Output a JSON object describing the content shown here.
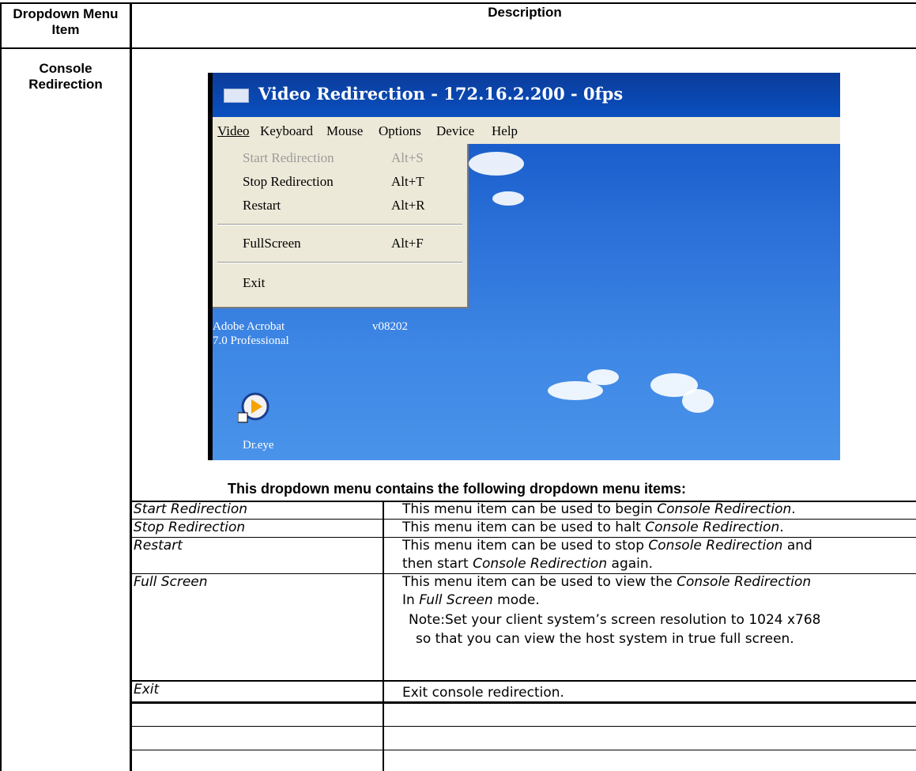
{
  "table": {
    "header_col1": "Dropdown Menu Item",
    "header_col2": "Description",
    "row_label": "Console Redirection"
  },
  "screenshot": {
    "window_title": "Video Redirection - 172.16.2.200 - 0fps",
    "menu": [
      "Video",
      "Keyboard",
      "Mouse",
      "Options",
      "Device",
      "Help"
    ],
    "dropdown": [
      {
        "label": "Start Redirection",
        "shortcut": "Alt+S",
        "disabled": true
      },
      {
        "label": "Stop Redirection",
        "shortcut": "Alt+T",
        "disabled": false
      },
      {
        "label": "Restart",
        "shortcut": "Alt+R",
        "disabled": false
      },
      {
        "label": "FullScreen",
        "shortcut": "Alt+F",
        "disabled": false
      },
      {
        "label": "Exit",
        "shortcut": "",
        "disabled": false
      }
    ],
    "desktop_icons": [
      {
        "label": "Adobe Acrobat\n7.0 Professional"
      },
      {
        "label": "v08202"
      },
      {
        "label": "Dr.eye"
      }
    ]
  },
  "intro": "This dropdown menu contains the following dropdown menu items:",
  "items": [
    {
      "name": "Start Redirection",
      "desc_parts": [
        "This menu item can be used to begin ",
        "Console Redirection",
        "."
      ]
    },
    {
      "name": "Stop Redirection",
      "desc_parts": [
        "This menu item can be used to halt ",
        "Console Redirection",
        "."
      ]
    },
    {
      "name": "Restart",
      "desc_line1": [
        "This menu item can be used to stop ",
        "Console Redirection",
        " and"
      ],
      "desc_line2": [
        "then start ",
        "Console Redirection",
        " again."
      ]
    },
    {
      "name": "Full Screen",
      "desc_line1": [
        "This menu item can be used to view the ",
        "Console Redirection"
      ],
      "desc_line2": [
        " In ",
        "Full Screen",
        " mode."
      ],
      "desc_line3": "Note:Set your client system’s screen resolution to 1024 x768",
      "desc_line4": "so that you can view the host system in true full screen."
    },
    {
      "name": "Exit",
      "desc": "Exit console redirection."
    }
  ]
}
